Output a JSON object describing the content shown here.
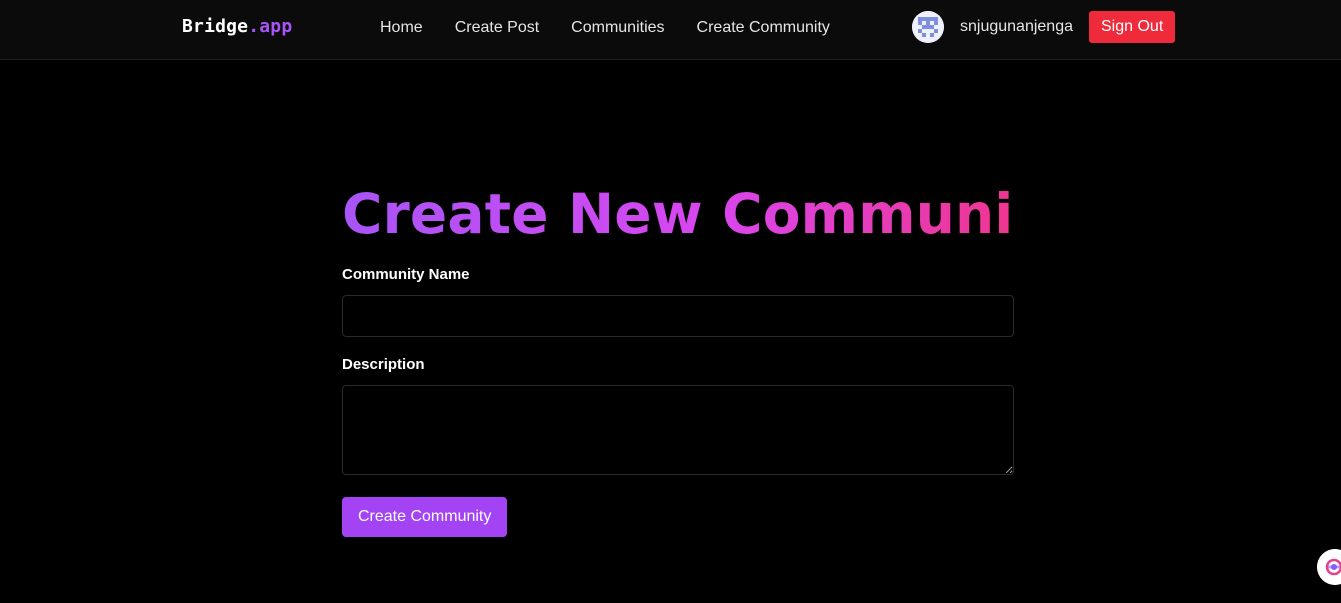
{
  "app": {
    "logo_main": "Bridge",
    "logo_suffix": ".app",
    "accent_color": "#a855f7"
  },
  "nav": {
    "links": [
      {
        "label": "Home"
      },
      {
        "label": "Create Post"
      },
      {
        "label": "Communities"
      },
      {
        "label": "Create Community"
      }
    ]
  },
  "user": {
    "avatar_icon": "identicon-avatar",
    "username": "snjugunanjenga",
    "sign_out_label": "Sign Out",
    "sign_out_color": "#ef2b3b"
  },
  "form": {
    "title": "Create New Community",
    "title_gradient": [
      "#a855f7",
      "#d946ef",
      "#f0358f"
    ],
    "name_label": "Community Name",
    "name_value": "",
    "description_label": "Description",
    "description_value": "",
    "submit_label": "Create Community",
    "submit_color": "#a343f3"
  },
  "floating_widget": {
    "icon": "assistant-widget-icon"
  }
}
